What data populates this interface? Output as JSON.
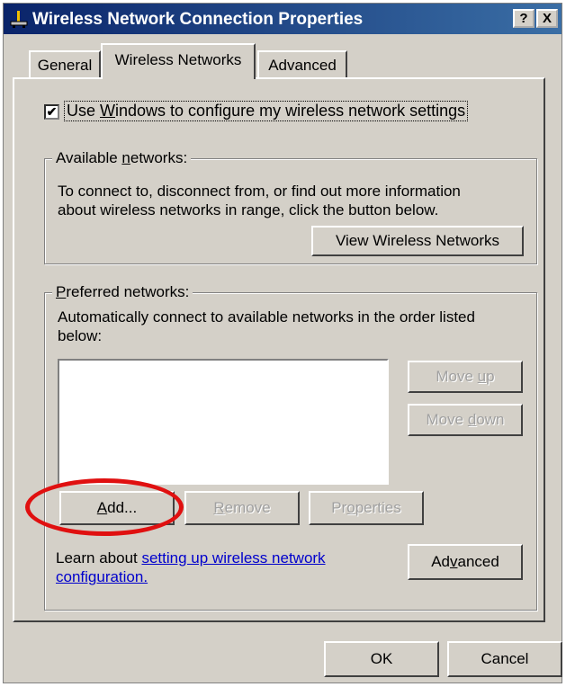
{
  "window": {
    "title": "Wireless Network Connection Properties",
    "help_button": "?",
    "close_button": "X"
  },
  "tabs": [
    {
      "label": "General"
    },
    {
      "label": "Wireless Networks"
    },
    {
      "label": "Advanced"
    }
  ],
  "checkbox": {
    "checked": "true",
    "mark": "✔",
    "label_prefix": "Use ",
    "label_accel": "W",
    "label_suffix": "indows to configure my wireless network settings"
  },
  "available": {
    "legend_prefix": "Available ",
    "legend_accel": "n",
    "legend_suffix": "etworks:",
    "line1": "To connect to, disconnect from, or find out more information",
    "line2": "about wireless networks in range, click the button below.",
    "view_button": "View Wireless Networks"
  },
  "preferred": {
    "legend_accel": "P",
    "legend_suffix": "referred networks:",
    "line1": "Automatically connect to available networks in the order listed",
    "line2": "below:",
    "move_up_prefix": "Move ",
    "move_up_accel": "u",
    "move_up_suffix": "p",
    "move_down_prefix": "Move ",
    "move_down_accel": "d",
    "move_down_suffix": "own",
    "add_accel": "A",
    "add_suffix": "dd...",
    "remove_accel": "R",
    "remove_suffix": "emove",
    "properties_prefix": "Pr",
    "properties_accel": "o",
    "properties_suffix": "perties",
    "learn_text": "Learn about ",
    "link_line1": "setting up wireless network",
    "link_line2": "configuration.",
    "advanced_prefix": "Ad",
    "advanced_accel": "v",
    "advanced_suffix": "anced"
  },
  "footer": {
    "ok_label": "OK",
    "cancel_label": "Cancel"
  },
  "colors": {
    "titlebar": "#0a246a",
    "highlight_circle": "#e01010",
    "link": "#0000cc"
  }
}
